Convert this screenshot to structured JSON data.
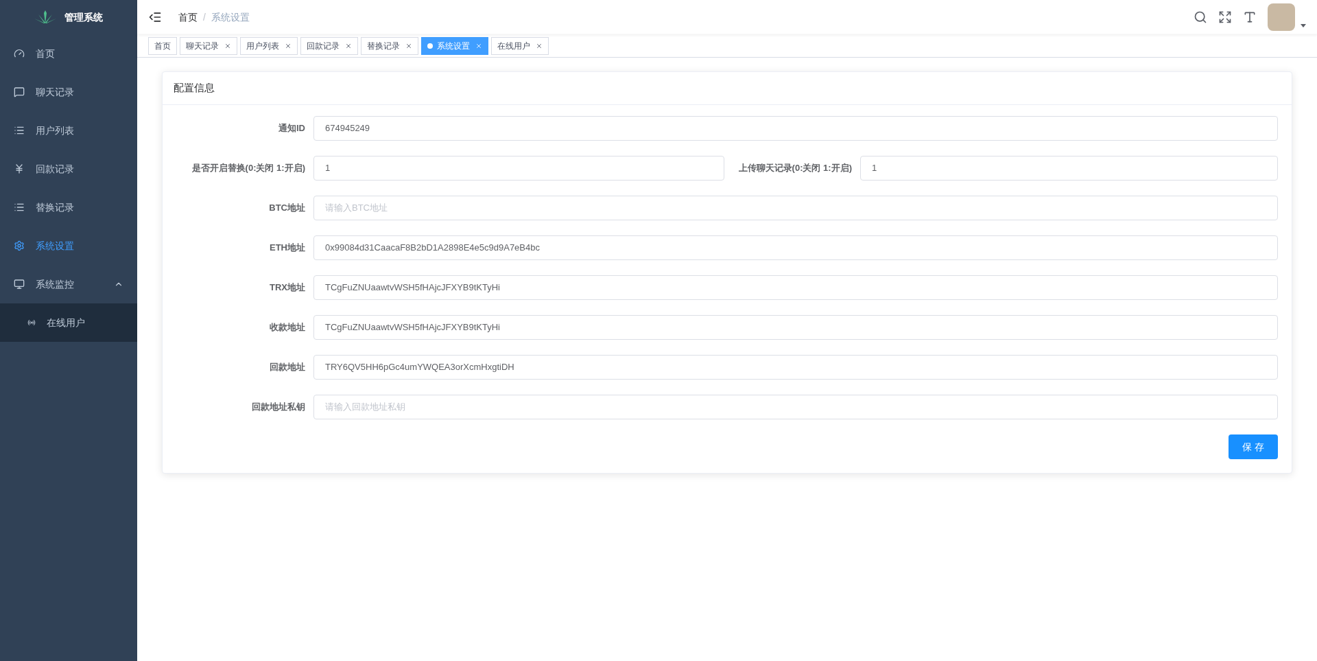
{
  "sidebar": {
    "title": "管理系统",
    "items": [
      {
        "kind": "dashboard",
        "label": "首页",
        "selected": false
      },
      {
        "kind": "chat",
        "label": "聊天记录",
        "selected": false
      },
      {
        "kind": "list",
        "label": "用户列表",
        "selected": false
      },
      {
        "kind": "yen",
        "label": "回款记录",
        "selected": false
      },
      {
        "kind": "list",
        "label": "替换记录",
        "selected": false
      },
      {
        "kind": "gear",
        "label": "系统设置",
        "selected": true
      },
      {
        "kind": "monitor",
        "label": "系统监控",
        "selected": false,
        "expanded": true,
        "children": [
          {
            "kind": "signal",
            "label": "在线用户",
            "selected": false
          }
        ]
      }
    ]
  },
  "breadcrumb": {
    "separator": "/",
    "items": [
      "首页",
      "系统设置"
    ]
  },
  "tabs": [
    {
      "label": "首页",
      "selected": false,
      "closable": false
    },
    {
      "label": "聊天记录",
      "selected": false,
      "closable": true
    },
    {
      "label": "用户列表",
      "selected": false,
      "closable": true
    },
    {
      "label": "回款记录",
      "selected": false,
      "closable": true
    },
    {
      "label": "替换记录",
      "selected": false,
      "closable": true
    },
    {
      "label": "系统设置",
      "selected": true,
      "closable": true
    },
    {
      "label": "在线用户",
      "selected": false,
      "closable": true
    }
  ],
  "card": {
    "title": "配置信息",
    "rows": [
      [
        {
          "label": "通知ID",
          "value": "674945249"
        }
      ],
      [
        {
          "label": "是否开启替换(0:关闭 1:开启)",
          "value": "1"
        },
        {
          "label": "上传聊天记录(0:关闭 1:开启)",
          "value": "1"
        }
      ],
      [
        {
          "label": "BTC地址",
          "placeholder": "请输入BTC地址"
        }
      ],
      [
        {
          "label": "ETH地址",
          "value": "0x99084d31CaacaF8B2bD1A2898E4e5c9d9A7eB4bc"
        }
      ],
      [
        {
          "label": "TRX地址",
          "value": "TCgFuZNUaawtvWSH5fHAjcJFXYB9tKTyHi"
        }
      ],
      [
        {
          "label": "收款地址",
          "value": "TCgFuZNUaawtvWSH5fHAjcJFXYB9tKTyHi"
        }
      ],
      [
        {
          "label": "回款地址",
          "value": "TRY6QV5HH6pGc4umYWQEA3orXcmHxgtiDH"
        }
      ],
      [
        {
          "label": "回款地址私钥",
          "placeholder": "请输入回款地址私钥"
        }
      ]
    ],
    "save_button": "保 存"
  }
}
